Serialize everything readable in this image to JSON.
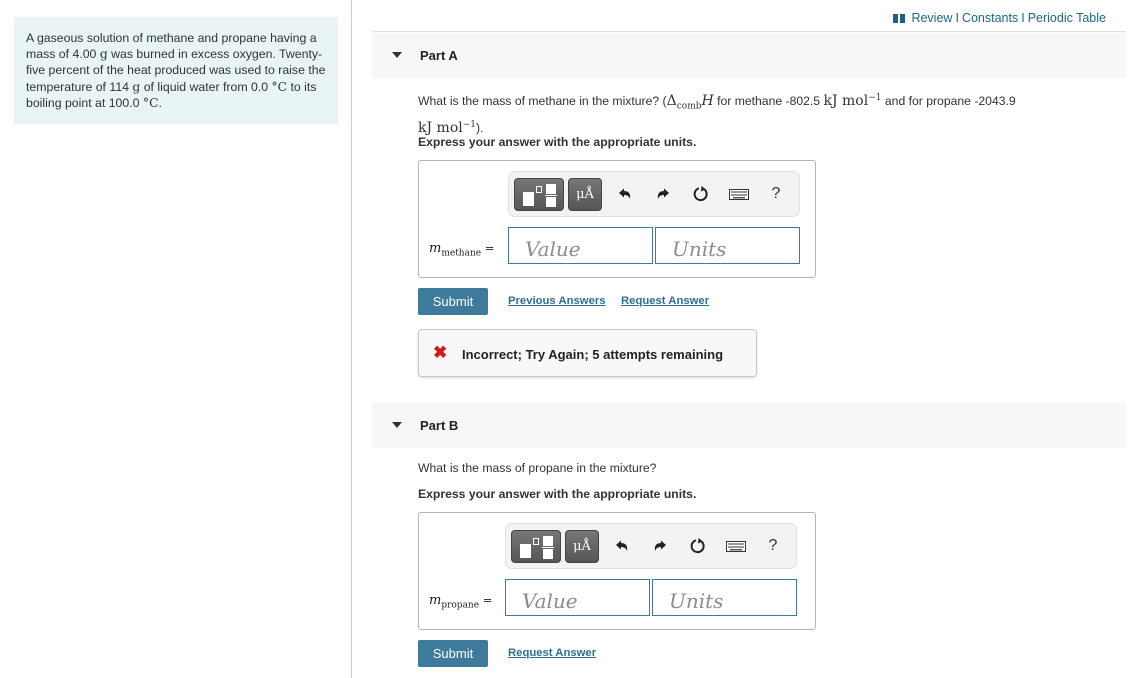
{
  "problem": {
    "intro_parts": [
      "A gaseous solution of methane and propane having a mass of 4.00 ",
      "g",
      " was burned in excess oxygen. Twenty-five percent of the heat produced was used to raise the temperature of 114 ",
      "g",
      " of liquid water from 0.0 ",
      "°C",
      " to its boiling point at 100.0 ",
      "°C",
      "."
    ]
  },
  "topbar": {
    "review": "Review",
    "constants": "Constants",
    "periodic_table": "Periodic Table",
    "separator": "I"
  },
  "toolbar": {
    "units_label": "μÅ",
    "help_label": "?"
  },
  "part_a": {
    "title": "Part A",
    "question_pre": "What is the mass of methane in the mixture? (",
    "delta": "Δ",
    "comb": "comb",
    "H": "H",
    "for_methane": " for methane -802.5 ",
    "unit_kj_mol": "kJ mol",
    "exp": "−1",
    "for_propane": " and for propane -2043.9",
    "unit_kj_mol_2": "kJ mol",
    "exp_2": "−1",
    "question_end": ").",
    "instruction": "Express your answer with the appropriate units.",
    "var_m": "m",
    "var_sub": "methane",
    "equals": " =",
    "value_placeholder": "Value",
    "units_placeholder": "Units",
    "submit": "Submit",
    "previous_answers": "Previous Answers",
    "request_answer": "Request Answer",
    "feedback_icon": "✖",
    "feedback": "Incorrect; Try Again; 5 attempts remaining"
  },
  "part_b": {
    "title": "Part B",
    "question": "What is the mass of propane in the mixture?",
    "instruction": "Express your answer with the appropriate units.",
    "var_m": "m",
    "var_sub": "propane",
    "equals": " =",
    "value_placeholder": "Value",
    "units_placeholder": "Units",
    "submit": "Submit",
    "request_answer": "Request Answer"
  },
  "colors": {
    "accent": "#3d7a9b",
    "link": "#2b6f93",
    "error": "#d11b1b",
    "info_bg": "#e8f4f6"
  }
}
